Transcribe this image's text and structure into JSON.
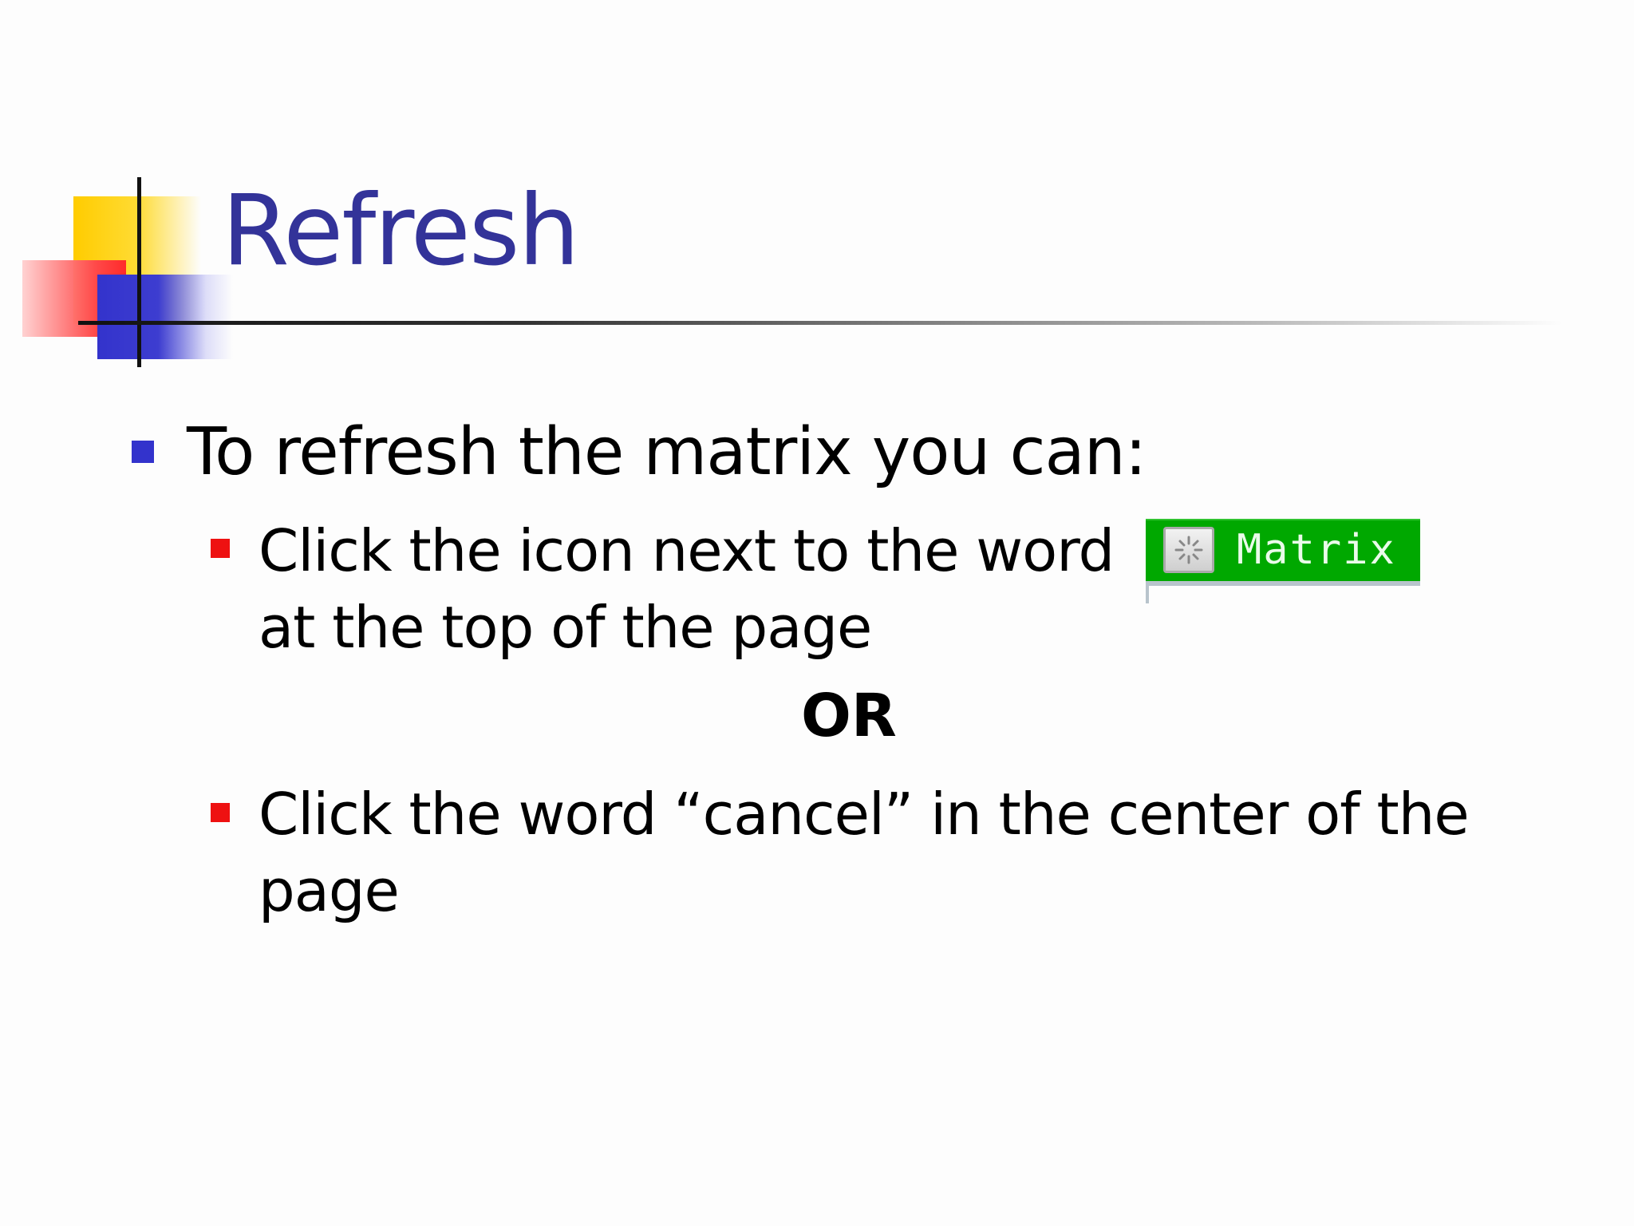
{
  "slide": {
    "title": "Refresh",
    "main_bullet": "To refresh the matrix you can:",
    "sub_bullets": [
      {
        "line1": "Click the icon next to the word",
        "line2": "at the top of the page"
      },
      {
        "line1": "Click the word “cancel” in the center of the",
        "line2": "page"
      }
    ],
    "separator": "OR"
  },
  "matrix_button": {
    "label": "Matrix",
    "icon": "refresh-icon",
    "color": "#00a800"
  },
  "colors": {
    "title": "#333399",
    "bullet_level1": "#3333cc",
    "bullet_level2": "#ee1111",
    "deco_yellow": "#ffcc00",
    "deco_red": "#ff3333",
    "deco_blue": "#3333cc"
  }
}
